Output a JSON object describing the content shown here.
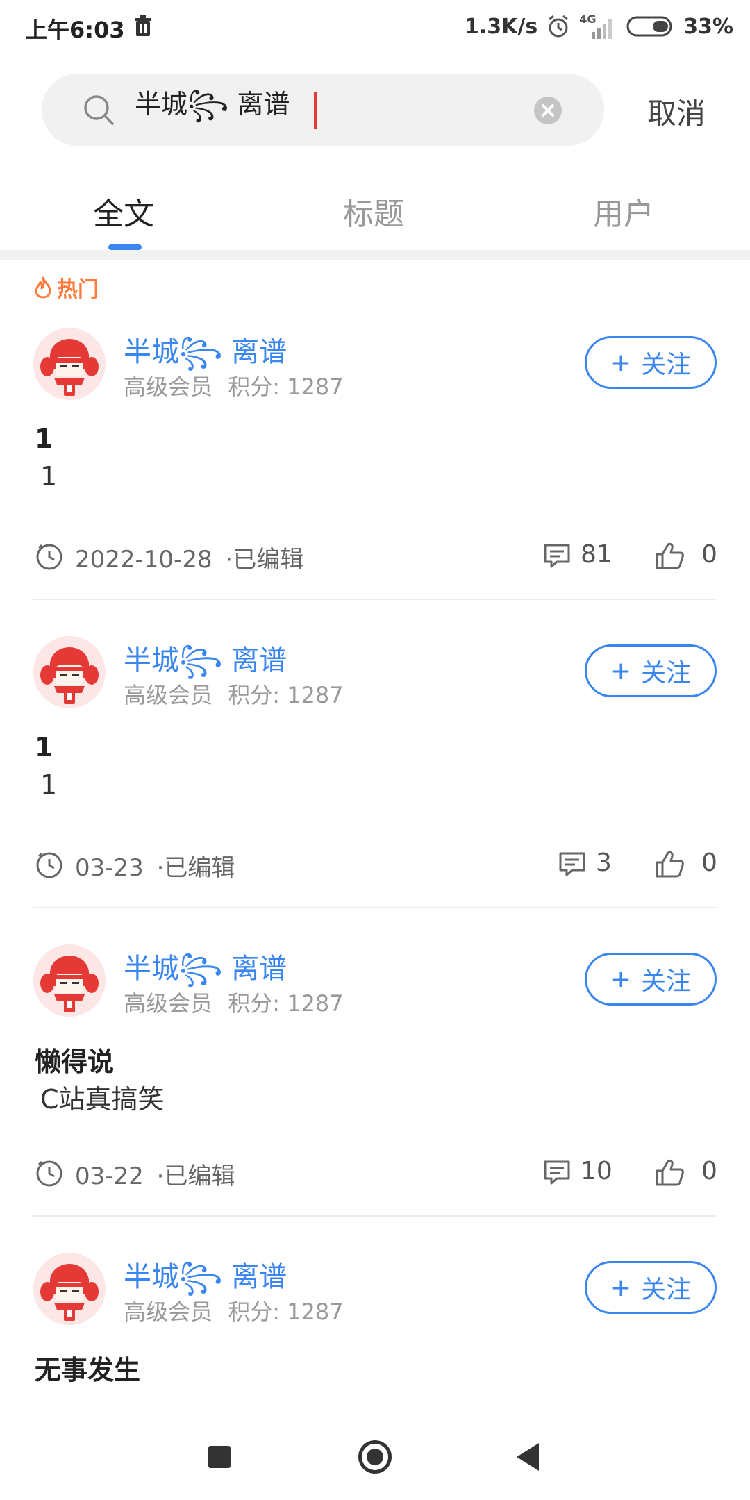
{
  "status_bar": {
    "time": "上午6:03",
    "network_speed": "1.3K/s",
    "network_type": "4G",
    "battery": "33%"
  },
  "search": {
    "value": "半城꧂ 离谱",
    "cancel_label": "取消"
  },
  "tabs": [
    {
      "label": "全文",
      "active": true
    },
    {
      "label": "标题",
      "active": false
    },
    {
      "label": "用户",
      "active": false
    }
  ],
  "section": {
    "hot_label": "热门"
  },
  "posts": [
    {
      "username": "半城꧂ 离谱",
      "member_level": "高级会员",
      "points": "积分: 1287",
      "follow_label": "关注",
      "title": "1",
      "body": "1",
      "date": "2022-10-28",
      "edited": "·已编辑",
      "comments": "81",
      "likes": "0"
    },
    {
      "username": "半城꧂ 离谱",
      "member_level": "高级会员",
      "points": "积分: 1287",
      "follow_label": "关注",
      "title": "1",
      "body": "1",
      "date": "03-23",
      "edited": "·已编辑",
      "comments": "3",
      "likes": "0"
    },
    {
      "username": "半城꧂ 离谱",
      "member_level": "高级会员",
      "points": "积分: 1287",
      "follow_label": "关注",
      "title": "懒得说",
      "body": "C站真搞笑",
      "date": "03-22",
      "edited": "·已编辑",
      "comments": "10",
      "likes": "0"
    },
    {
      "username": "半城꧂ 离谱",
      "member_level": "高级会员",
      "points": "积分: 1287",
      "follow_label": "关注",
      "title": "无事发生"
    }
  ],
  "colors": {
    "accent": "#3a86f0",
    "hot": "#ff7a3a",
    "caret": "#e53935"
  },
  "icons": {
    "status": [
      "trash-icon",
      "alarm-icon",
      "signal-icon",
      "battery-icon"
    ],
    "search": "search-icon",
    "clear": "clear-icon",
    "hot": "flame-icon",
    "footer": [
      "clock-icon",
      "comment-icon",
      "like-icon"
    ],
    "nav": [
      "recent-apps-icon",
      "home-icon",
      "back-icon"
    ]
  }
}
